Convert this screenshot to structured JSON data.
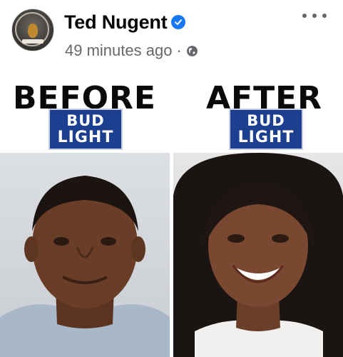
{
  "post": {
    "author": "Ted Nugent",
    "timestamp": "49 minutes ago",
    "separator": "·",
    "audience_icon": "globe-icon",
    "verified_icon": "verified-badge-icon",
    "more_icon": "more-options-icon"
  },
  "meme": {
    "before_title": "BEFORE",
    "after_title": "AFTER",
    "logo_line1": "BUD",
    "logo_line2": "LIGHT",
    "logo_color": "#1d3f8f"
  }
}
